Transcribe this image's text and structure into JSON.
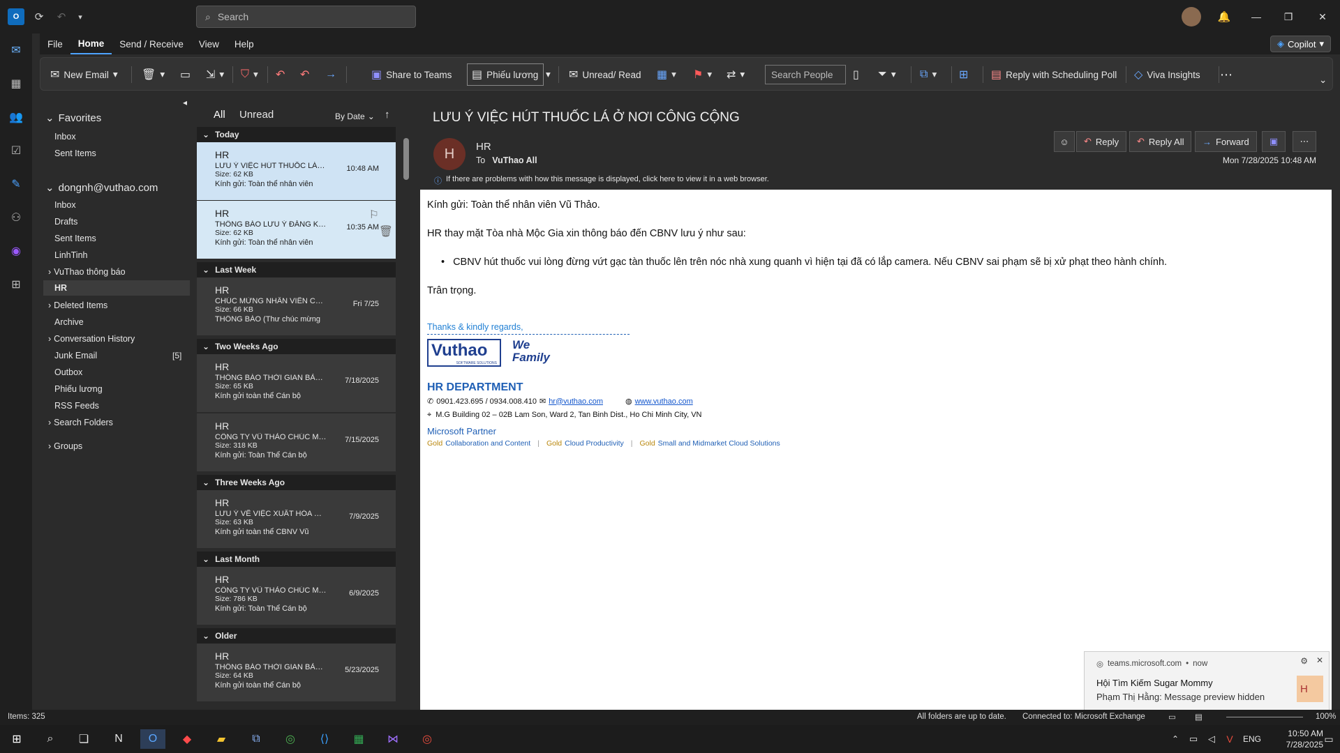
{
  "titlebar": {
    "search_placeholder": "Search"
  },
  "menu": {
    "items": [
      "File",
      "Home",
      "Send / Receive",
      "View",
      "Help"
    ],
    "copilot": "Copilot"
  },
  "ribbon": {
    "new_email": "New Email",
    "share_to_teams": "Share to Teams",
    "category": "Phiếu lương",
    "unread_read": "Unread/ Read",
    "search_people": "Search People",
    "reply_poll": "Reply with Scheduling Poll",
    "viva": "Viva Insights"
  },
  "folders": {
    "favorites": "Favorites",
    "fav_items": [
      "Inbox",
      "Sent Items"
    ],
    "account": "dongnh@vuthao.com",
    "acct_items": [
      "Inbox",
      "Drafts",
      "Sent Items",
      "LinhTinh"
    ],
    "vuthao": "VuThao thông báo",
    "hr": "HR",
    "more_items": [
      "Deleted Items",
      "Archive"
    ],
    "conv_history": "Conversation History",
    "junk": "Junk Email",
    "junk_count": "[5]",
    "more_items2": [
      "Outbox",
      "Phiếu lương",
      "RSS Feeds"
    ],
    "search_folders": "Search Folders",
    "groups": "Groups"
  },
  "list": {
    "tab_all": "All",
    "tab_unread": "Unread",
    "sort": "By Date",
    "groups": [
      "Today",
      "Last Week",
      "Two Weeks Ago",
      "Three Weeks Ago",
      "Last Month",
      "Older"
    ],
    "items": [
      {
        "sender": "HR",
        "subject": "LƯU Ý VIỆC HÚT THUỐC LÁ Ở ...",
        "size": "Size: 62 KB",
        "date": "10:48 AM",
        "preview": "Kính gửi: Toàn thể nhân viên"
      },
      {
        "sender": "HR",
        "subject": "THÔNG BÁO LƯU Ý ĐĂNG KÝ ...",
        "size": "Size: 62 KB",
        "date": "10:35 AM",
        "preview": "Kính gửi: Toàn thể nhân viên"
      },
      {
        "sender": "HR",
        "subject": "CHÚC MỪNG NHÂN VIÊN CHÍ...",
        "size": "Size: 66 KB",
        "date": "Fri 7/25",
        "preview": "THÔNG BÁO  (Thư chúc mừng"
      },
      {
        "sender": "HR",
        "subject": "THÔNG BÁO THỜI GIAN BẢO ...",
        "size": "Size: 65 KB",
        "date": "7/18/2025",
        "preview": "Kính gửi toàn thể Cán bộ"
      },
      {
        "sender": "HR",
        "subject": "CÔNG TY VŨ THẢO CHÚC MỪ...",
        "size": "Size: 318 KB",
        "date": "7/15/2025",
        "preview": "Kính gửi: Toàn Thể Cán bộ"
      },
      {
        "sender": "HR",
        "subject": "LƯU Ý VỀ VIỆC XUẤT HÓA ĐƠ...",
        "size": "Size: 63 KB",
        "date": "7/9/2025",
        "preview": "Kính gửi toàn thể CBNV Vũ"
      },
      {
        "sender": "HR",
        "subject": "CÔNG TY VŨ THẢO CHÚC MỪ...",
        "size": "Size: 786 KB",
        "date": "6/9/2025",
        "preview": "Kính gửi: Toàn Thể Cán bộ"
      },
      {
        "sender": "HR",
        "subject": "THÔNG BÁO THỜI GIAN BẢO ...",
        "size": "Size: 64 KB",
        "date": "5/23/2025",
        "preview": "Kính gửi toàn thể Cán bộ"
      }
    ]
  },
  "message": {
    "subject": "LƯU Ý VIỆC HÚT THUỐC LÁ Ở NƠI CÔNG CỘNG",
    "avatar": "H",
    "sender": "HR",
    "to_label": "To",
    "to": "VuThao  All",
    "reply": "Reply",
    "reply_all": "Reply All",
    "forward": "Forward",
    "date": "Mon 7/28/2025 10:48 AM",
    "info": "If there are problems with how this message is displayed, click here to view it in a web browser.",
    "greeting": "Kính gửi: Toàn thể nhân viên Vũ Thảo.",
    "intro": "HR thay mặt Tòa nhà Mộc Gia xin thông báo đến CBNV lưu ý như sau:",
    "bullet": "CBNV hút thuốc vui lòng đừng vứt gạc tàn thuốc lên trên nóc nhà xung quanh vì hiện tại đã có lắp camera. Nếu CBNV sai phạm sẽ bị xử phạt theo hành chính.",
    "closing": "Trân trọng.",
    "sig_thanks": "Thanks & kindly regards,",
    "logo_text": "Vuthao",
    "logo_sub": "SOFTWARE SOLUTIONS",
    "family": "We Family",
    "dept": "HR DEPARTMENT",
    "phone": "0901.423.695 / 0934.008.410",
    "email": "hr@vuthao.com",
    "web": "www.vuthao.com",
    "address": "M.G Building 02 – 02B Lam Son, Ward 2, Tan Binh Dist., Ho Chi Minh City, VN",
    "partner": "Microsoft Partner",
    "gold1": "Gold",
    "comp1": "Collaboration and Content",
    "gold2": "Gold",
    "comp2": "Cloud Productivity",
    "gold3": "Gold",
    "comp3": "Small and Midmarket Cloud Solutions"
  },
  "status": {
    "items": "Items: 325",
    "uptodate": "All folders are up to date.",
    "connected": "Connected to: Microsoft Exchange",
    "zoom": "100%"
  },
  "toast": {
    "source": "teams.microsoft.com",
    "time": "now",
    "title": "Hội Tìm Kiếm Sugar Mommy",
    "body": "Phạm Thị Hằng: Message preview hidden",
    "avatar": "H"
  },
  "taskbar": {
    "lang": "ENG",
    "time": "10:50 AM",
    "date": "7/28/2025"
  },
  "colors": {
    "accent": "#4da3ff",
    "selected_item": "#cfe3f4",
    "link": "#1155cc",
    "sig_blue": "#1f5fb5"
  }
}
